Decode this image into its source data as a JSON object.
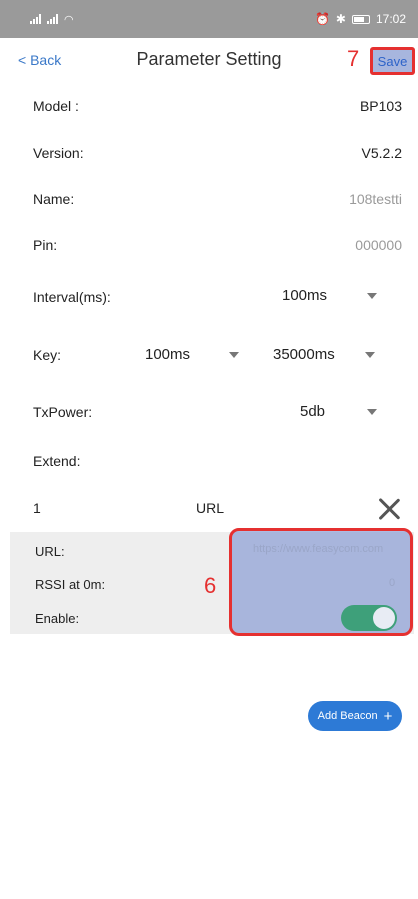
{
  "status_bar": {
    "time": "17:02"
  },
  "nav": {
    "back_label": "< Back",
    "title": "Parameter Setting",
    "save_label": "Save"
  },
  "markers": {
    "save": "7",
    "panel": "6"
  },
  "fields": {
    "model": {
      "label": "Model :",
      "value": "BP103"
    },
    "version": {
      "label": "Version:",
      "value": "V5.2.2"
    },
    "name": {
      "label": "Name:",
      "value": "108testti"
    },
    "pin": {
      "label": "Pin:",
      "value": "000000"
    },
    "interval": {
      "label": "Interval(ms):",
      "value": "100ms"
    },
    "key": {
      "label": "Key:",
      "value1": "100ms",
      "value2": "35000ms"
    },
    "txpower": {
      "label": "TxPower:",
      "value": "5db"
    },
    "extend": {
      "label": "Extend:"
    }
  },
  "beacon": {
    "index": "1",
    "type": "URL",
    "url_label": "URL:",
    "url_value": "https://www.feasycom.com",
    "rssi_label": "RSSI at 0m:",
    "rssi_value": "0",
    "enable_label": "Enable:",
    "enabled": true
  },
  "add_beacon_label": "Add Beacon",
  "colors": {
    "accent": "#2d7ad6",
    "highlight": "#e53030",
    "toggle_on": "#3ea07a"
  }
}
